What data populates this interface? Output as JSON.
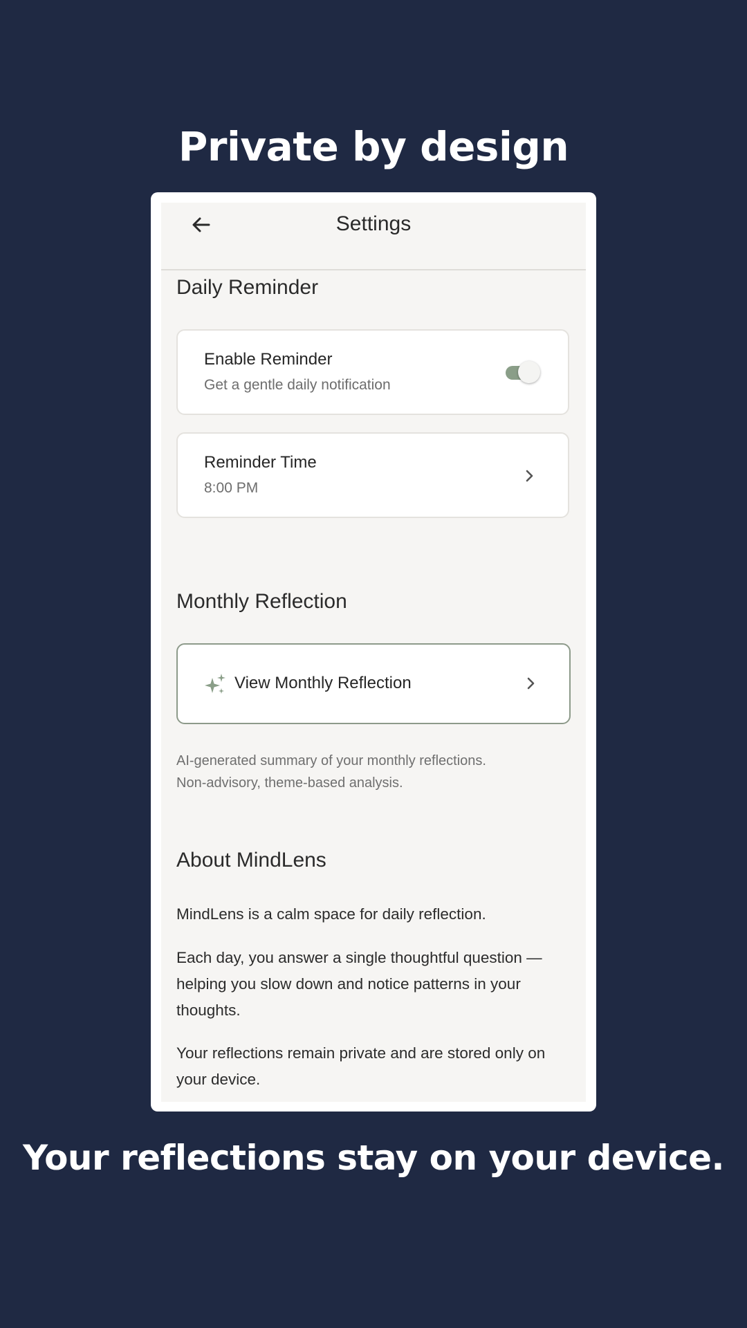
{
  "headline": "Private by design",
  "tagline": "Your reflections stay on your device.",
  "app": {
    "title": "Settings",
    "daily_reminder": {
      "heading": "Daily Reminder",
      "enable": {
        "title": "Enable Reminder",
        "subtitle": "Get a gentle daily notification",
        "enabled": true
      },
      "time": {
        "title": "Reminder Time",
        "value": "8:00 PM"
      }
    },
    "monthly_reflection": {
      "heading": "Monthly Reflection",
      "button_label": "View Monthly Reflection",
      "note_line1": "AI-generated summary of your monthly reflections.",
      "note_line2": "Non-advisory, theme-based analysis."
    },
    "about": {
      "heading": "About MindLens",
      "paragraph1": "MindLens is a calm space for daily reflection.",
      "paragraph2": "Each day, you answer a single thoughtful question — helping you slow down and notice patterns in your thoughts.",
      "paragraph3": "Your reflections remain private and are stored only on your device."
    }
  },
  "colors": {
    "background": "#1f2943",
    "screen": "#f6f5f3",
    "accent": "#8a9e88"
  },
  "icons": [
    "back-arrow-icon",
    "sparkle-icon",
    "chevron-right-icon"
  ]
}
